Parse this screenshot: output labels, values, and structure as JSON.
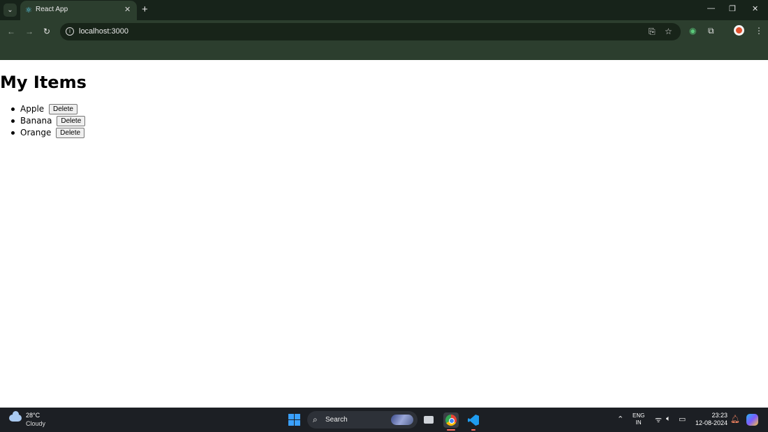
{
  "browser": {
    "tab": {
      "title": "React App"
    },
    "new_tab_symbol": "+",
    "address_bar": {
      "url": "localhost:3000"
    },
    "window_controls": {
      "minimize": "—",
      "restore": "❐",
      "close": "✕"
    }
  },
  "page": {
    "heading": "My Items",
    "items": [
      {
        "name": "Apple",
        "button_label": "Delete"
      },
      {
        "name": "Banana",
        "button_label": "Delete"
      },
      {
        "name": "Orange",
        "button_label": "Delete"
      }
    ]
  },
  "taskbar": {
    "weather": {
      "temperature": "28°C",
      "condition": "Cloudy"
    },
    "search_label": "Search",
    "language": {
      "primary": "ENG",
      "secondary": "IN"
    },
    "clock": {
      "time": "23:23",
      "date": "12-08-2024"
    }
  },
  "colors": {
    "chrome_dark": "#17231a",
    "chrome_toolbar": "#2c3e2e",
    "taskbar": "#1c1f24",
    "accent_blue": "#3aa0ff"
  }
}
